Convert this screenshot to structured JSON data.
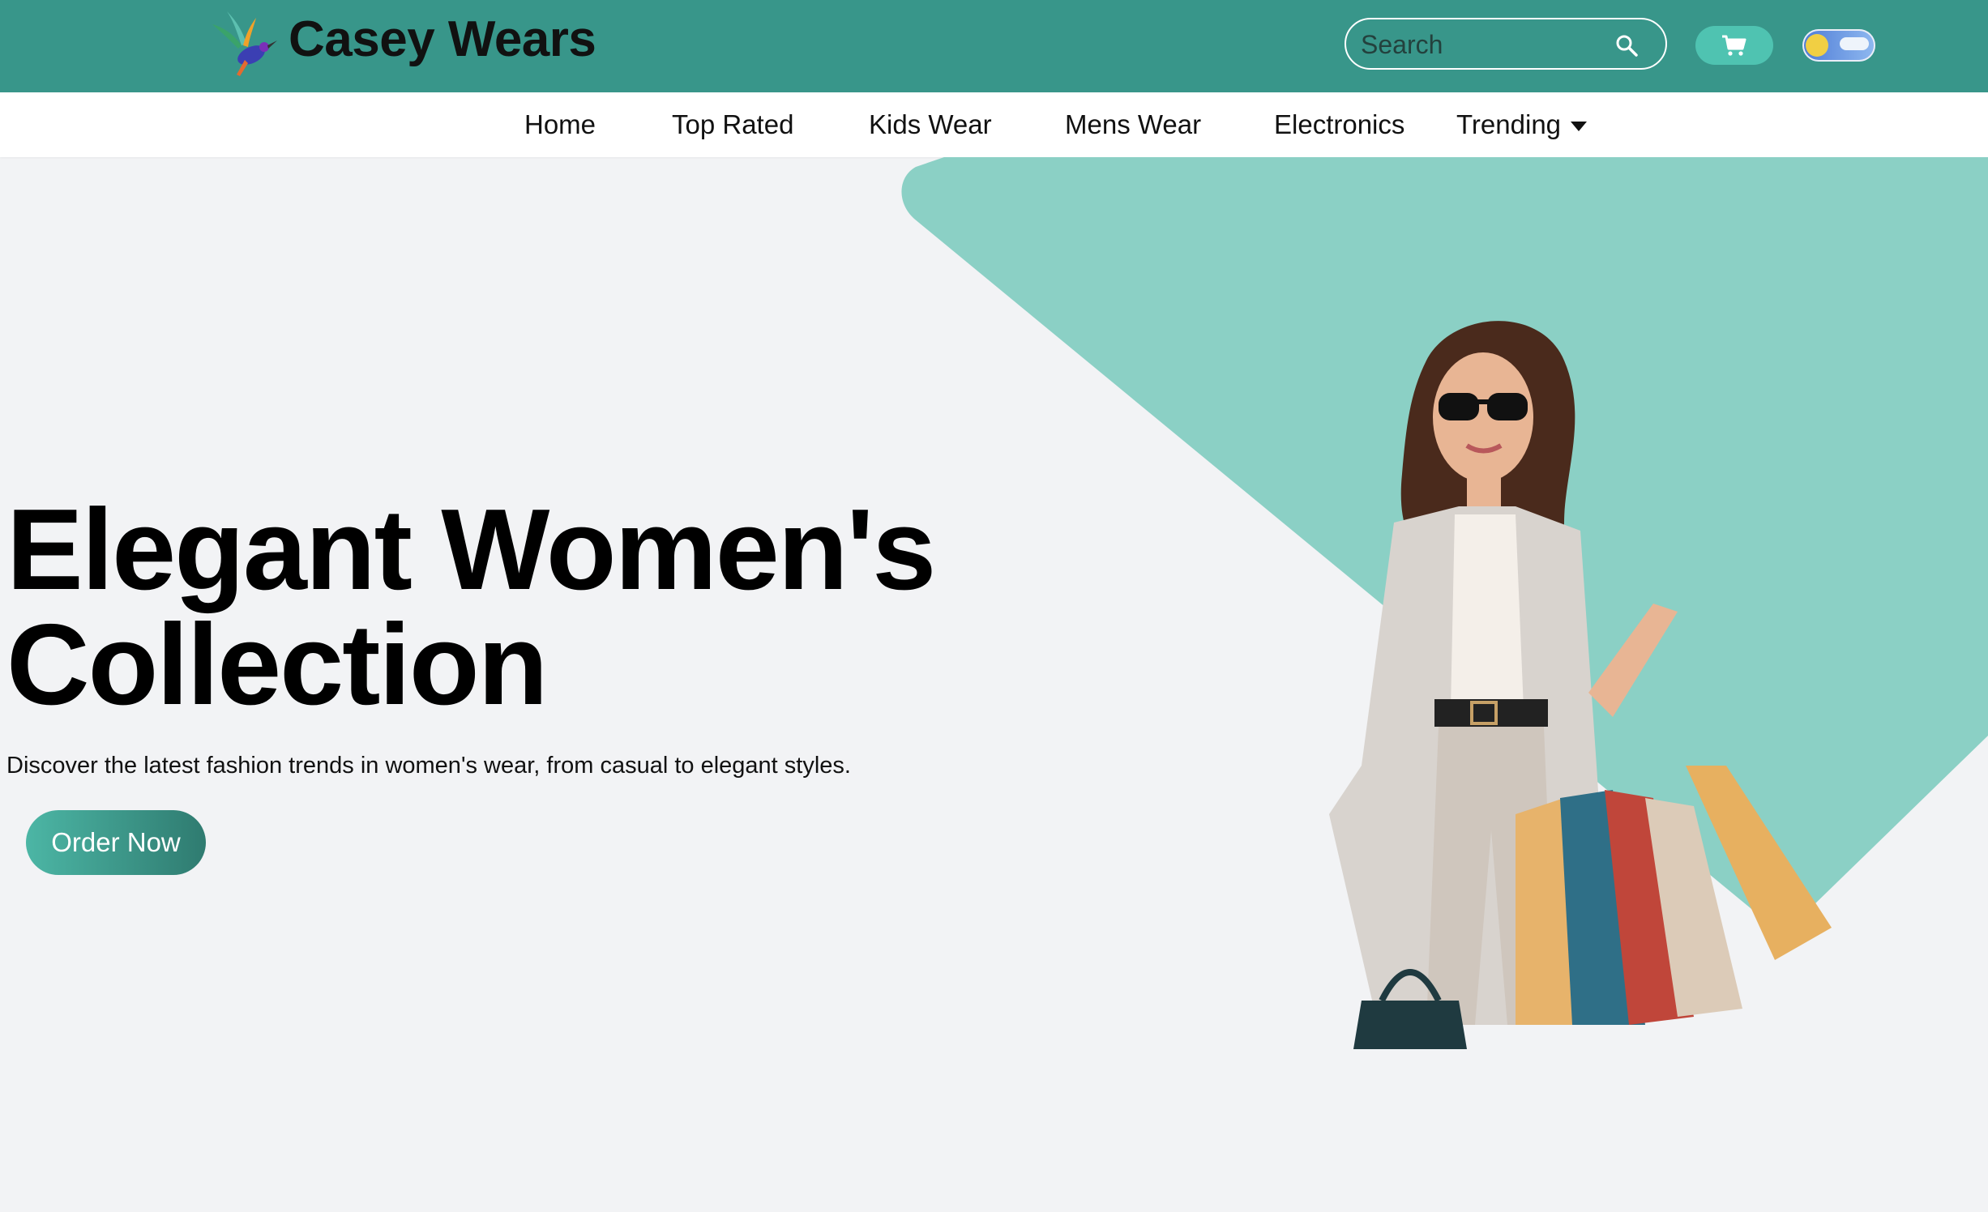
{
  "header": {
    "brand": "Casey Wears",
    "logo_icon": "hummingbird-icon",
    "search": {
      "placeholder": "Search",
      "icon": "search-icon"
    },
    "cart_icon": "cart-icon",
    "theme_toggle_icon": "sun-cloud-toggle-icon"
  },
  "nav": {
    "items": [
      {
        "label": "Home"
      },
      {
        "label": "Top Rated"
      },
      {
        "label": "Kids Wear"
      },
      {
        "label": "Mens Wear"
      },
      {
        "label": "Electronics"
      },
      {
        "label": "Trending",
        "icon": "caret-down-icon"
      }
    ]
  },
  "hero": {
    "title_line1": "Elegant Women's",
    "title_line2": "Collection",
    "description": "Discover the latest fashion trends in women's wear, from casual to elegant styles.",
    "cta_label": "Order Now",
    "image_icon": "fashion-model-shopping-bags-image"
  },
  "colors": {
    "header_bg": "#38968a",
    "accent_shape": "#8bd0c5",
    "page_bg": "#f2f3f5",
    "button_start": "#4cb6a5",
    "button_end": "#2f7b70"
  }
}
